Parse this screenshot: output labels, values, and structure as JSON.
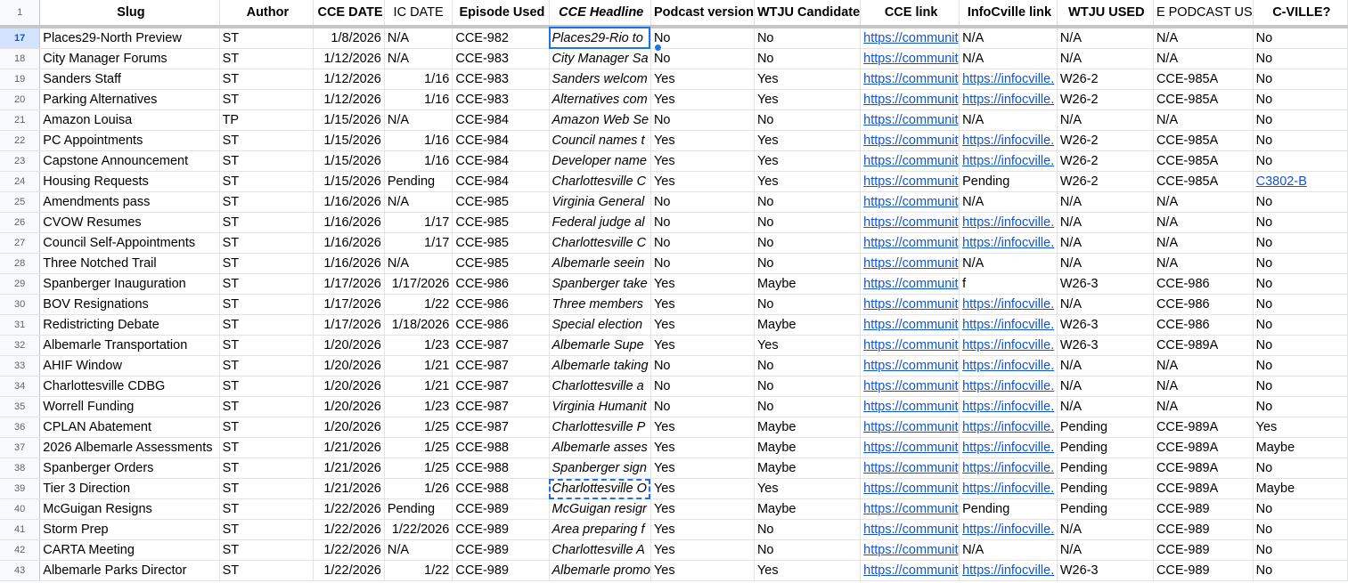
{
  "columns": {
    "slug": "Slug",
    "author": "Author",
    "cce_date": "CCE DATE",
    "ic_date": "IC DATE",
    "episode": "Episode Used",
    "headline": "CCE Headline",
    "podcast": "Podcast version",
    "wtju_cand": "WTJU Candidate",
    "cce_link": "CCE link",
    "ic_link": "InfoCville link",
    "wtju_used": "WTJU USED",
    "podcast_used": "E PODCAST US",
    "cville": "C-VILLE?"
  },
  "header_row_number": "1",
  "rows": [
    {
      "n": "17",
      "slug": "Places29-North Preview",
      "author": "ST",
      "cce_date": "1/8/2026",
      "ic_date": "N/A",
      "episode": "CCE-982",
      "headline": "Places29-Rio to",
      "podcast": "No",
      "wtju_cand": "No",
      "cce_link": "https://communit",
      "ic_link": "N/A",
      "wtju_used": "N/A",
      "podcast_used": "N/A",
      "cville": "No"
    },
    {
      "n": "18",
      "slug": "City Manager Forums",
      "author": "ST",
      "cce_date": "1/12/2026",
      "ic_date": "N/A",
      "episode": "CCE-983",
      "headline": "City Manager Sa",
      "podcast": "No",
      "wtju_cand": "No",
      "cce_link": "https://communit",
      "ic_link": "N/A",
      "wtju_used": "N/A",
      "podcast_used": "N/A",
      "cville": "No"
    },
    {
      "n": "19",
      "slug": "Sanders Staff",
      "author": "ST",
      "cce_date": "1/12/2026",
      "ic_date": "1/16",
      "episode": "CCE-983",
      "headline": "Sanders welcom",
      "podcast": "Yes",
      "wtju_cand": "Yes",
      "cce_link": "https://communit",
      "ic_link": "https://infocville.",
      "wtju_used": "W26-2",
      "podcast_used": "CCE-985A",
      "cville": "No"
    },
    {
      "n": "20",
      "slug": "Parking Alternatives",
      "author": "ST",
      "cce_date": "1/12/2026",
      "ic_date": "1/16",
      "episode": "CCE-983",
      "headline": "Alternatives com",
      "podcast": "Yes",
      "wtju_cand": "Yes",
      "cce_link": "https://communit",
      "ic_link": "https://infocville.",
      "wtju_used": "W26-2",
      "podcast_used": "CCE-985A",
      "cville": "No"
    },
    {
      "n": "21",
      "slug": "Amazon Louisa",
      "author": "TP",
      "cce_date": "1/15/2026",
      "ic_date": "N/A",
      "episode": "CCE-984",
      "headline": "Amazon Web Se",
      "podcast": "No",
      "wtju_cand": "No",
      "cce_link": "https://communit",
      "ic_link": "N/A",
      "wtju_used": "N/A",
      "podcast_used": "N/A",
      "cville": "No"
    },
    {
      "n": "22",
      "slug": "PC Appointments",
      "author": "ST",
      "cce_date": "1/15/2026",
      "ic_date": "1/16",
      "episode": "CCE-984",
      "headline": "Council names t",
      "podcast": "Yes",
      "wtju_cand": "Yes",
      "cce_link": "https://communit",
      "ic_link": "https://infocville.",
      "wtju_used": "W26-2",
      "podcast_used": "CCE-985A",
      "cville": "No"
    },
    {
      "n": "23",
      "slug": "Capstone Announcement",
      "author": "ST",
      "cce_date": "1/15/2026",
      "ic_date": "1/16",
      "episode": "CCE-984",
      "headline": "Developer name",
      "podcast": "Yes",
      "wtju_cand": "Yes",
      "cce_link": "https://communit",
      "ic_link": "https://infocville.",
      "wtju_used": "W26-2",
      "podcast_used": "CCE-985A",
      "cville": "No"
    },
    {
      "n": "24",
      "slug": "Housing Requests",
      "author": "ST",
      "cce_date": "1/15/2026",
      "ic_date": "Pending",
      "episode": "CCE-984",
      "headline": "Charlottesville C",
      "podcast": "Yes",
      "wtju_cand": "Yes",
      "cce_link": "https://communit",
      "ic_link": "Pending",
      "wtju_used": "W26-2",
      "podcast_used": "CCE-985A",
      "cville": "C3802-B"
    },
    {
      "n": "25",
      "slug": "Amendments pass",
      "author": "ST",
      "cce_date": "1/16/2026",
      "ic_date": "N/A",
      "episode": "CCE-985",
      "headline": "Virginia General",
      "podcast": "No",
      "wtju_cand": "No",
      "cce_link": "https://communit",
      "ic_link": "N/A",
      "wtju_used": "N/A",
      "podcast_used": "N/A",
      "cville": "No"
    },
    {
      "n": "26",
      "slug": "CVOW Resumes",
      "author": "ST",
      "cce_date": "1/16/2026",
      "ic_date": "1/17",
      "episode": "CCE-985",
      "headline": "Federal judge al",
      "podcast": "No",
      "wtju_cand": "No",
      "cce_link": "https://communit",
      "ic_link": "https://infocville.",
      "wtju_used": "N/A",
      "podcast_used": "N/A",
      "cville": "No"
    },
    {
      "n": "27",
      "slug": "Council Self-Appointments",
      "author": "ST",
      "cce_date": "1/16/2026",
      "ic_date": "1/17",
      "episode": "CCE-985",
      "headline": "Charlottesville C",
      "podcast": "No",
      "wtju_cand": "No",
      "cce_link": "https://communit",
      "ic_link": "https://infocville.",
      "wtju_used": "N/A",
      "podcast_used": "N/A",
      "cville": "No"
    },
    {
      "n": "28",
      "slug": "Three Notched Trail",
      "author": "ST",
      "cce_date": "1/16/2026",
      "ic_date": "N/A",
      "episode": "CCE-985",
      "headline": "Albemarle seein",
      "podcast": "No",
      "wtju_cand": "No",
      "cce_link": "https://communit",
      "ic_link": "N/A",
      "wtju_used": "N/A",
      "podcast_used": "N/A",
      "cville": "No"
    },
    {
      "n": "29",
      "slug": "Spanberger Inauguration",
      "author": "ST",
      "cce_date": "1/17/2026",
      "ic_date": "1/17/2026",
      "episode": "CCE-986",
      "headline": "Spanberger take",
      "podcast": "Yes",
      "wtju_cand": "Maybe",
      "cce_link": "https://communit",
      "ic_link": "f",
      "wtju_used": "W26-3",
      "podcast_used": "CCE-986",
      "cville": "No"
    },
    {
      "n": "30",
      "slug": "BOV Resignations",
      "author": "ST",
      "cce_date": "1/17/2026",
      "ic_date": "1/22",
      "episode": "CCE-986",
      "headline": "Three members",
      "podcast": "Yes",
      "wtju_cand": "No",
      "cce_link": "https://communit",
      "ic_link": "https://infocville.",
      "wtju_used": "N/A",
      "podcast_used": "CCE-986",
      "cville": "No"
    },
    {
      "n": "31",
      "slug": "Redistricting Debate",
      "author": "ST",
      "cce_date": "1/17/2026",
      "ic_date": "1/18/2026",
      "episode": "CCE-986",
      "headline": "Special election",
      "podcast": "Yes",
      "wtju_cand": "Maybe",
      "cce_link": "https://communit",
      "ic_link": "https://infocville.",
      "wtju_used": "W26-3",
      "podcast_used": "CCE-986",
      "cville": "No"
    },
    {
      "n": "32",
      "slug": "Albemarle Transportation",
      "author": "ST",
      "cce_date": "1/20/2026",
      "ic_date": "1/23",
      "episode": "CCE-987",
      "headline": "Albemarle Supe",
      "podcast": "Yes",
      "wtju_cand": "Yes",
      "cce_link": "https://communit",
      "ic_link": "https://infocville.",
      "wtju_used": "W26-3",
      "podcast_used": "CCE-989A",
      "cville": "No"
    },
    {
      "n": "33",
      "slug": "AHIF Window",
      "author": "ST",
      "cce_date": "1/20/2026",
      "ic_date": "1/21",
      "episode": "CCE-987",
      "headline": "Albemarle taking",
      "podcast": "No",
      "wtju_cand": "No",
      "cce_link": "https://communit",
      "ic_link": "https://infocville.",
      "wtju_used": "N/A",
      "podcast_used": "N/A",
      "cville": "No"
    },
    {
      "n": "34",
      "slug": "Charlottesville CDBG",
      "author": "ST",
      "cce_date": "1/20/2026",
      "ic_date": "1/21",
      "episode": "CCE-987",
      "headline": "Charlottesville a",
      "podcast": "No",
      "wtju_cand": "No",
      "cce_link": "https://communit",
      "ic_link": "https://infocville.",
      "wtju_used": "N/A",
      "podcast_used": "N/A",
      "cville": "No"
    },
    {
      "n": "35",
      "slug": "Worrell Funding",
      "author": "ST",
      "cce_date": "1/20/2026",
      "ic_date": "1/23",
      "episode": "CCE-987",
      "headline": "Virginia Humanit",
      "podcast": "No",
      "wtju_cand": "No",
      "cce_link": "https://communit",
      "ic_link": "https://infocville.",
      "wtju_used": "N/A",
      "podcast_used": "N/A",
      "cville": "No"
    },
    {
      "n": "36",
      "slug": "CPLAN Abatement",
      "author": "ST",
      "cce_date": "1/20/2026",
      "ic_date": "1/25",
      "episode": "CCE-987",
      "headline": "Charlottesville P",
      "podcast": "Yes",
      "wtju_cand": "Maybe",
      "cce_link": "https://communit",
      "ic_link": "https://infocville.",
      "wtju_used": "Pending",
      "podcast_used": "CCE-989A",
      "cville": "Yes"
    },
    {
      "n": "37",
      "slug": "2026 Albemarle Assessments",
      "author": "ST",
      "cce_date": "1/21/2026",
      "ic_date": "1/25",
      "episode": "CCE-988",
      "headline": "Albemarle asses",
      "podcast": "Yes",
      "wtju_cand": "Maybe",
      "cce_link": "https://communit",
      "ic_link": "https://infocville.",
      "wtju_used": "Pending",
      "podcast_used": "CCE-989A",
      "cville": "Maybe"
    },
    {
      "n": "38",
      "slug": "Spanberger Orders",
      "author": "ST",
      "cce_date": "1/21/2026",
      "ic_date": "1/25",
      "episode": "CCE-988",
      "headline": "Spanberger sign",
      "podcast": "Yes",
      "wtju_cand": "Maybe",
      "cce_link": "https://communit",
      "ic_link": "https://infocville.",
      "wtju_used": "Pending",
      "podcast_used": "CCE-989A",
      "cville": "No"
    },
    {
      "n": "39",
      "slug": "Tier 3 Direction",
      "author": "ST",
      "cce_date": "1/21/2026",
      "ic_date": "1/26",
      "episode": "CCE-988",
      "headline": "Charlottesville O",
      "podcast": "Yes",
      "wtju_cand": "Yes",
      "cce_link": "https://communit",
      "ic_link": "https://infocville.",
      "wtju_used": "Pending",
      "podcast_used": "CCE-989A",
      "cville": "Maybe"
    },
    {
      "n": "40",
      "slug": "McGuigan Resigns",
      "author": "ST",
      "cce_date": "1/22/2026",
      "ic_date": "Pending",
      "episode": "CCE-989",
      "headline": "McGuigan resigr",
      "podcast": "Yes",
      "wtju_cand": "Maybe",
      "cce_link": "https://communit",
      "ic_link": "Pending",
      "wtju_used": "Pending",
      "podcast_used": "CCE-989",
      "cville": "No"
    },
    {
      "n": "41",
      "slug": "Storm Prep",
      "author": "ST",
      "cce_date": "1/22/2026",
      "ic_date": "1/22/2026",
      "episode": "CCE-989",
      "headline": "Area preparing f",
      "podcast": "Yes",
      "wtju_cand": "No",
      "cce_link": "https://communit",
      "ic_link": "https://infocville.",
      "wtju_used": "N/A",
      "podcast_used": "CCE-989",
      "cville": "No"
    },
    {
      "n": "42",
      "slug": "CARTA Meeting",
      "author": "ST",
      "cce_date": "1/22/2026",
      "ic_date": "N/A",
      "episode": "CCE-989",
      "headline": "Charlottesville A",
      "podcast": "Yes",
      "wtju_cand": "No",
      "cce_link": "https://communit",
      "ic_link": "N/A",
      "wtju_used": "N/A",
      "podcast_used": "CCE-989",
      "cville": "No"
    },
    {
      "n": "43",
      "slug": "Albemarle Parks Director",
      "author": "ST",
      "cce_date": "1/22/2026",
      "ic_date": "1/22",
      "episode": "CCE-989",
      "headline": "Albemarle promo",
      "podcast": "Yes",
      "wtju_cand": "Yes",
      "cce_link": "https://communit",
      "ic_link": "https://infocville.",
      "wtju_used": "W26-3",
      "podcast_used": "CCE-989",
      "cville": "No"
    }
  ],
  "colors": {
    "link": "#1155cc",
    "selection": "#1a73e8",
    "active_row_header": "#d3e3fd"
  }
}
